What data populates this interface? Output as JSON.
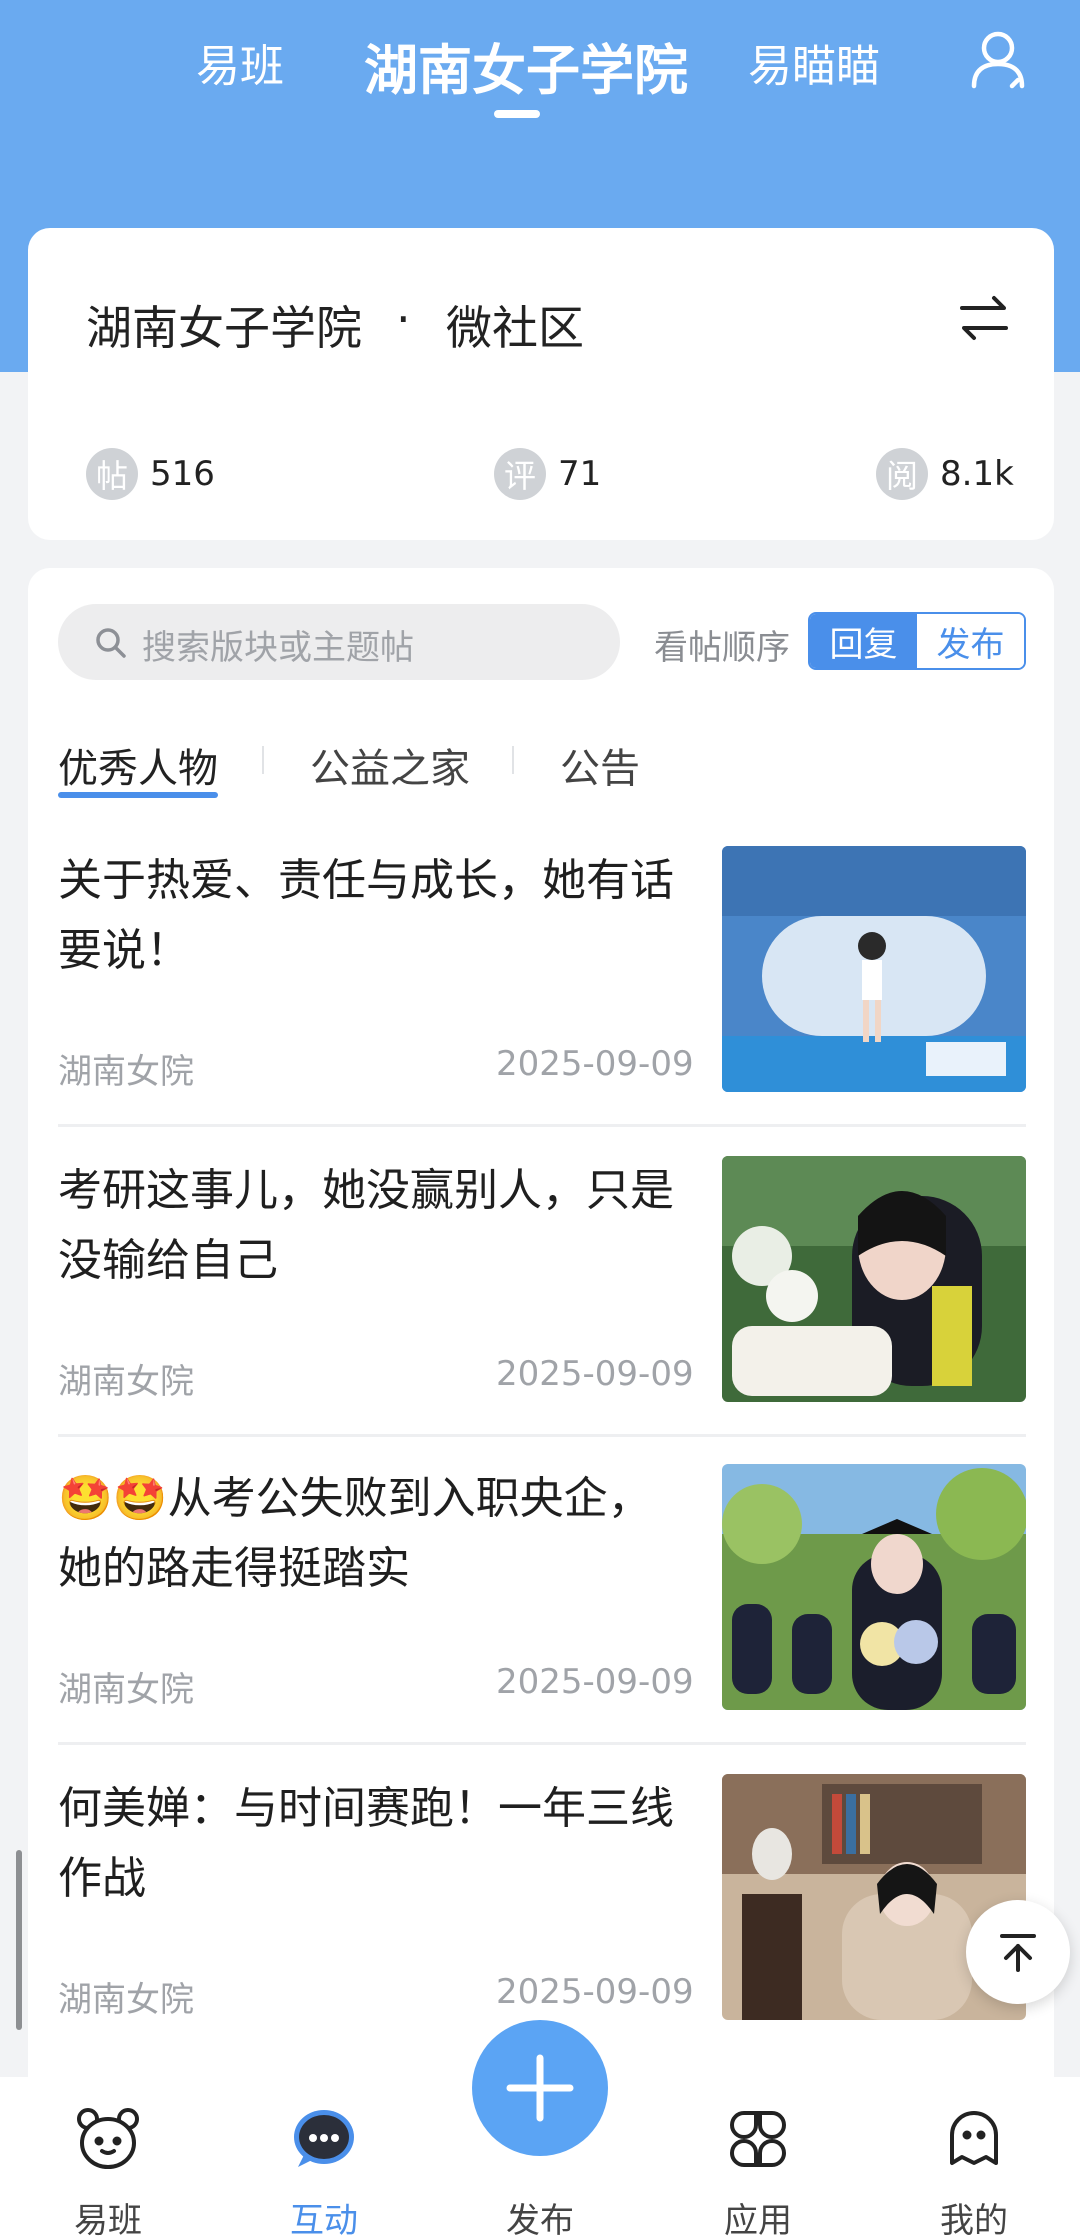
{
  "header": {
    "tabs": [
      {
        "label": "易班"
      },
      {
        "label": "湖南女子学院"
      },
      {
        "label": "易瞄瞄"
      }
    ]
  },
  "community": {
    "name": "湖南女子学院",
    "dot": "·",
    "subtitle": "微社区",
    "stats": [
      {
        "badge": "帖",
        "value": "516"
      },
      {
        "badge": "评",
        "value": "71"
      },
      {
        "badge": "阅",
        "value": "8.1k"
      }
    ]
  },
  "search": {
    "placeholder": "搜索版块或主题帖"
  },
  "sort": {
    "label": "看帖顺序",
    "reply": "回复",
    "publish": "发布"
  },
  "categories": [
    {
      "label": "优秀人物"
    },
    {
      "label": "公益之家"
    },
    {
      "label": "公告"
    }
  ],
  "posts": [
    {
      "title": "关于热爱、责任与成长，她有话要说！",
      "source": "湖南女院",
      "date": "2025-09-09"
    },
    {
      "title": "考研这事儿，她没赢别人，只是没输给自己",
      "source": "湖南女院",
      "date": "2025-09-09"
    },
    {
      "title": "🤩🤩从考公失败到入职央企，她的路走得挺踏实",
      "source": "湖南女院",
      "date": "2025-09-09"
    },
    {
      "title": "何美婵：与时间赛跑！一年三线作战",
      "source": "湖南女院",
      "date": "2025-09-09"
    }
  ],
  "nav": [
    {
      "label": "易班",
      "icon": "bear-face-icon"
    },
    {
      "label": "互动",
      "icon": "chat-bubble-icon"
    },
    {
      "label": "发布",
      "icon": "plus-icon"
    },
    {
      "label": "应用",
      "icon": "apps-grid-icon"
    },
    {
      "label": "我的",
      "icon": "ghost-profile-icon"
    }
  ],
  "colors": {
    "primary": "#6aaaf0",
    "accent": "#4a8fea",
    "fab": "#5ba4f4"
  }
}
